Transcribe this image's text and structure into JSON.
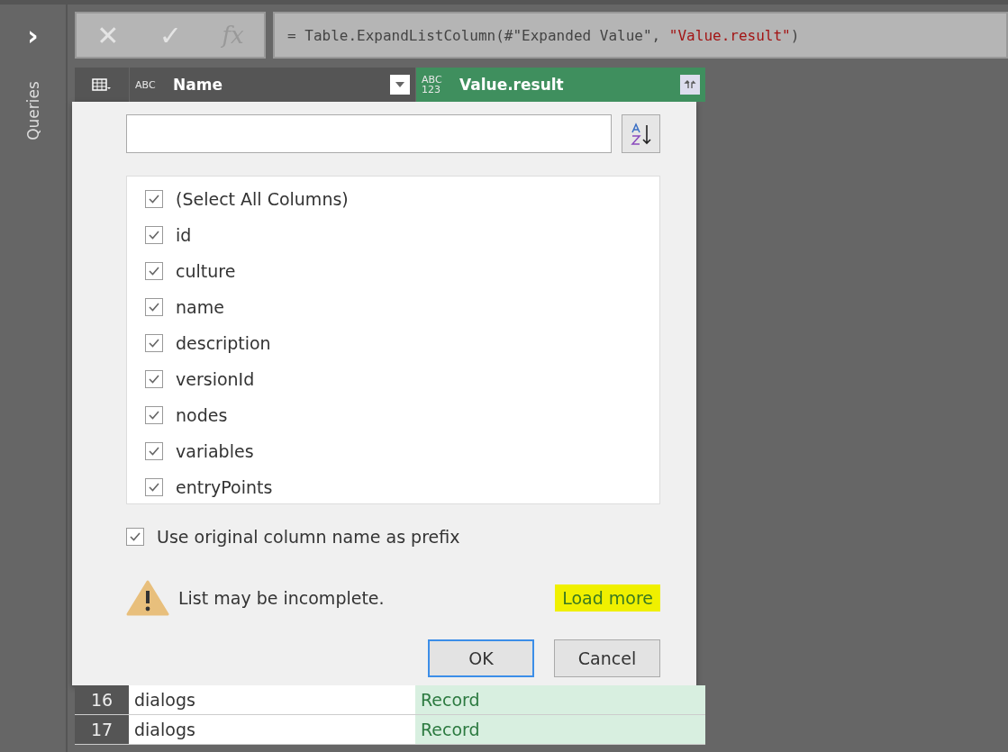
{
  "sidebar": {
    "expand_glyph": "›",
    "label": "Queries"
  },
  "formula_bar": {
    "cancel_glyph": "✕",
    "commit_glyph": "✓",
    "fx_label": "fx",
    "formula_parts": [
      {
        "kind": "code",
        "text": "= Table.ExpandListColumn(#\"Expanded Value\", "
      },
      {
        "kind": "string",
        "text": "\"Value.result\""
      },
      {
        "kind": "code",
        "text": ")"
      }
    ]
  },
  "table": {
    "columns": [
      {
        "type_label": "ABC",
        "name": "Name",
        "selected": false
      },
      {
        "type_label": "ABC 123",
        "name": "Value.result",
        "selected": true
      }
    ],
    "rows": [
      {
        "number": "16",
        "cells": [
          "dialogs",
          "Record"
        ]
      },
      {
        "number": "17",
        "cells": [
          "dialogs",
          "Record"
        ]
      }
    ]
  },
  "expand_popup": {
    "columns": [
      {
        "label": "(Select All Columns)",
        "checked": true
      },
      {
        "label": "id",
        "checked": true
      },
      {
        "label": "culture",
        "checked": true
      },
      {
        "label": "name",
        "checked": true
      },
      {
        "label": "description",
        "checked": true
      },
      {
        "label": "versionId",
        "checked": true
      },
      {
        "label": "nodes",
        "checked": true
      },
      {
        "label": "variables",
        "checked": true
      },
      {
        "label": "entryPoints",
        "checked": true
      }
    ],
    "use_prefix": {
      "label": "Use original column name as prefix",
      "checked": true
    },
    "warning": "List may be incomplete.",
    "load_more": {
      "label": "Load more",
      "highlighted": true
    },
    "buttons": [
      {
        "label": "OK",
        "selected": true
      },
      {
        "label": "Cancel",
        "selected": false
      }
    ]
  }
}
